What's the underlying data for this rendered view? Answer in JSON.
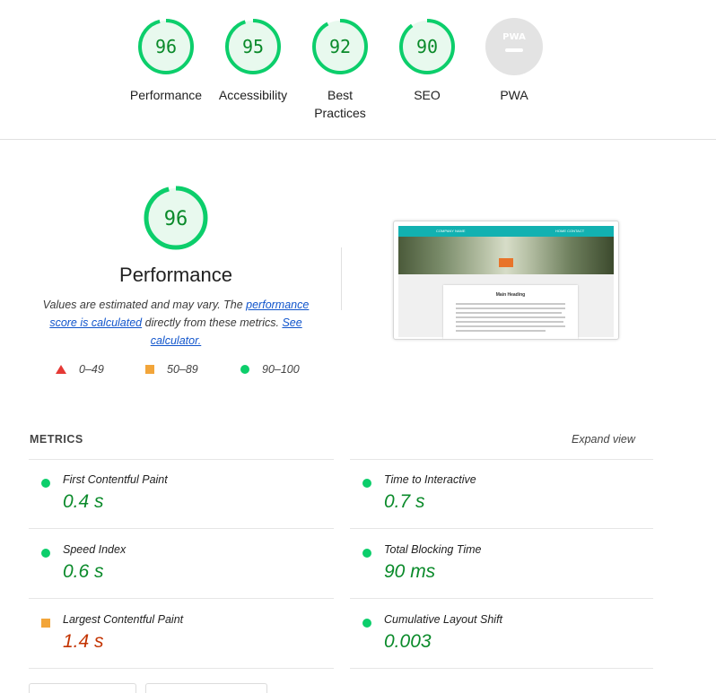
{
  "summary": {
    "gauges": [
      {
        "score": "96",
        "label": "Performance",
        "value": 96
      },
      {
        "score": "95",
        "label": "Accessibility",
        "value": 95
      },
      {
        "score": "92",
        "label": "Best\nPractices",
        "value": 92
      },
      {
        "score": "90",
        "label": "SEO",
        "value": 90
      },
      {
        "score": "PWA",
        "label": "PWA",
        "value": 0
      }
    ]
  },
  "performance": {
    "score": "96",
    "value": 96,
    "title": "Performance",
    "desc_1": "Values are estimated and may vary. The ",
    "desc_link_1": "performance score is calculated",
    "desc_2": " directly from these metrics. ",
    "desc_link_2": "See calculator.",
    "legend": {
      "fail": "0–49",
      "average": "50–89",
      "pass": "90–100"
    }
  },
  "thumbnail": {
    "nav_left": "COMPANY NAME",
    "nav_right": "HOME   CONTACT",
    "heading": "Main Heading"
  },
  "metrics": {
    "header": "METRICS",
    "expand": "Expand view",
    "items": [
      {
        "name": "First Contentful Paint",
        "value": "0.4 s",
        "status": "good"
      },
      {
        "name": "Time to Interactive",
        "value": "0.7 s",
        "status": "good"
      },
      {
        "name": "Speed Index",
        "value": "0.6 s",
        "status": "good"
      },
      {
        "name": "Total Blocking Time",
        "value": "90 ms",
        "status": "good"
      },
      {
        "name": "Largest Contentful Paint",
        "value": "1.4 s",
        "status": "avg"
      },
      {
        "name": "Cumulative Layout Shift",
        "value": "0.003",
        "status": "good"
      }
    ]
  },
  "colors": {
    "pass": "#0cce6b",
    "average": "#f2a53a",
    "fail": "#e53935",
    "pass_text": "#0a8a2a",
    "avg_text": "#c33300"
  }
}
